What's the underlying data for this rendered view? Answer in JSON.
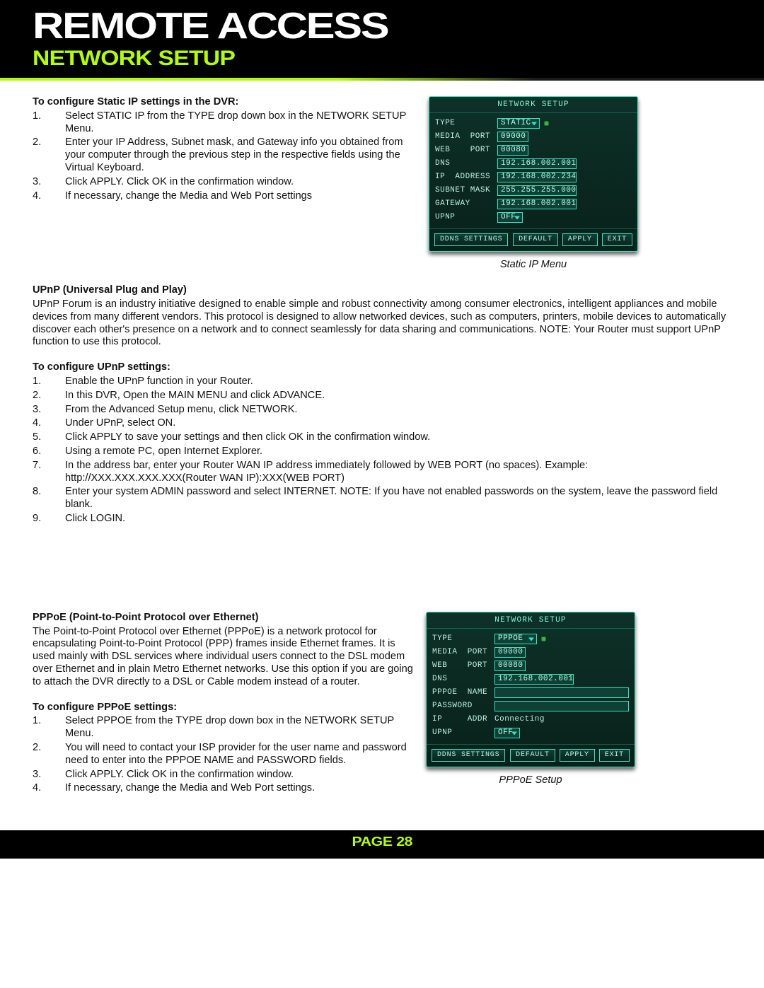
{
  "header": {
    "title": "REMOTE ACCESS",
    "subtitle": "NETWORK SETUP"
  },
  "footer": {
    "page": "Page 28"
  },
  "sections": {
    "static_ip": {
      "heading": "To configure Static IP settings in the DVR:",
      "steps": [
        "Select STATIC IP from the TYPE drop down box in the NETWORK SETUP Menu.",
        "Enter your IP Address, Subnet mask, and Gateway info you obtained from your computer through the previous step in the respective fields using the Virtual Keyboard.",
        "Click APPLY. Click OK in the confirmation window.",
        "If necessary, change the Media and Web Port settings"
      ]
    },
    "upnp": {
      "heading": "UPnP (Universal Plug and Play)",
      "body": "UPnP Forum is an industry initiative designed to enable simple and robust connectivity among consumer electronics, intelligent appliances and mobile devices from many different vendors. This protocol is designed to allow networked devices, such as computers, printers, mobile devices to automatically discover each other's presence on a network and to connect seamlessly for data sharing and communications. NOTE: Your Router must support UPnP function to use this protocol.",
      "config_heading": "To configure UPnP settings:",
      "steps": [
        "Enable the UPnP function in your Router.",
        "In this DVR, Open the MAIN MENU and click ADVANCE.",
        "From the Advanced Setup menu, click NETWORK.",
        "Under UPnP, select ON.",
        "Click APPLY to save your settings and then click OK in the confirmation window.",
        "Using a remote PC, open Internet Explorer.",
        "In the address bar, enter your Router WAN IP address immediately followed by WEB PORT (no spaces). Example: http://XXX.XXX.XXX.XXX(Router WAN IP):XXX(WEB PORT)",
        "Enter your system ADMIN password and select INTERNET. NOTE: If you have not enabled passwords on the system, leave the password field blank.",
        "Click LOGIN."
      ]
    },
    "pppoe": {
      "heading": "PPPoE (Point-to-Point Protocol over Ethernet)",
      "body": "The Point-to-Point Protocol over Ethernet (PPPoE) is a network protocol for encapsulating Point-to-Point Protocol (PPP) frames inside Ethernet frames. It is used mainly with DSL services where individual users connect to the DSL modem over Ethernet and in plain Metro Ethernet networks. Use this option if you are going to attach the DVR directly to a DSL or Cable modem instead of a router.",
      "config_heading": "To configure PPPoE settings:",
      "steps": [
        "Select PPPOE from the TYPE drop down box in the NETWORK SETUP Menu.",
        "You will need to contact your ISP provider for the user name and password need to enter into the PPPOE NAME and PASSWORD fields.",
        "Click APPLY. Click OK in the confirmation window.",
        "If necessary, change the Media and Web Port settings."
      ]
    }
  },
  "dvr_static": {
    "title": "NETWORK SETUP",
    "caption": "Static IP Menu",
    "rows": {
      "type_label": "TYPE",
      "type_value": "STATIC",
      "media_label": "MEDIA  PORT",
      "media_value": "09000",
      "web_label": "WEB    PORT",
      "web_value": "00080",
      "dns_label": "DNS",
      "dns_value": "192.168.002.001",
      "ip_label": "IP  ADDRESS",
      "ip_value": "192.168.002.234",
      "subnet_label": "SUBNET MASK",
      "subnet_value": "255.255.255.000",
      "gateway_label": "GATEWAY",
      "gateway_value": "192.168.002.001",
      "upnp_label": "UPNP",
      "upnp_value": "OFF"
    },
    "buttons": {
      "ddns": "DDNS SETTINGS",
      "default": "DEFAULT",
      "apply": "APPLY",
      "exit": "EXIT"
    }
  },
  "dvr_pppoe": {
    "title": "NETWORK SETUP",
    "caption": "PPPoE Setup",
    "rows": {
      "type_label": "TYPE",
      "type_value": "PPPOE",
      "media_label": "MEDIA  PORT",
      "media_value": "09000",
      "web_label": "WEB    PORT",
      "web_value": "00080",
      "dns_label": "DNS",
      "dns_value": "192.168.002.001",
      "pname_label": "PPPOE  NAME",
      "pname_value": "",
      "pass_label": "PASSWORD",
      "pass_value": "",
      "ipaddr_label": "IP     ADDR",
      "ipaddr_value": "Connecting",
      "upnp_label": "UPNP",
      "upnp_value": "OFF"
    },
    "buttons": {
      "ddns": "DDNS SETTINGS",
      "default": "DEFAULT",
      "apply": "APPLY",
      "exit": "EXIT"
    }
  }
}
